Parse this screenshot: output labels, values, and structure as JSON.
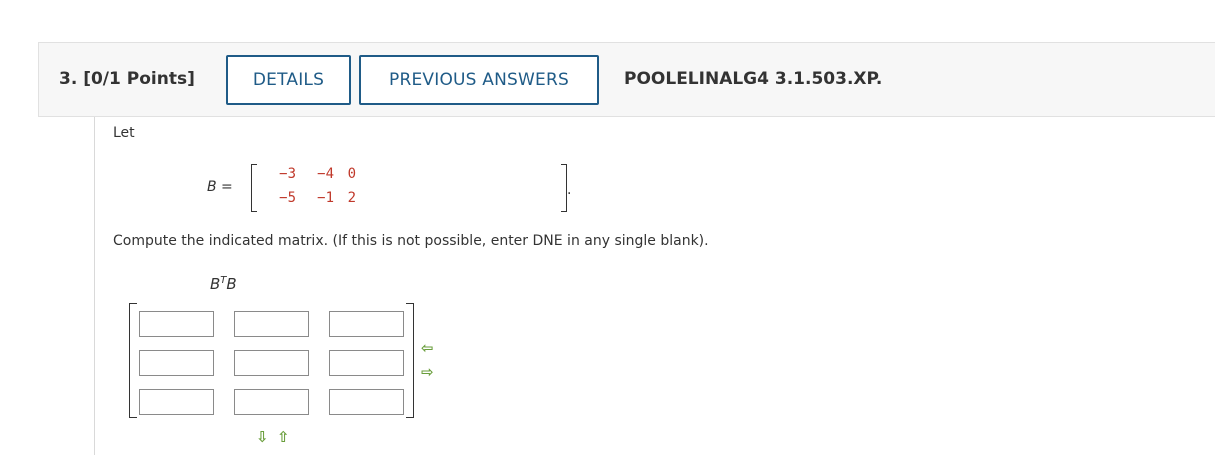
{
  "question": {
    "title": "3.  [0/1 Points]",
    "details_label": "DETAILS",
    "previous_answers_label": "PREVIOUS ANSWERS",
    "course_code": "POOLELINALG4 3.1.503.XP."
  },
  "content": {
    "intro": "Let",
    "matrix_label": "B  =",
    "matrix_values": [
      [
        "−3",
        "−4",
        "0"
      ],
      [
        "−5",
        "−1",
        "2"
      ]
    ],
    "period": ".",
    "instruction": "Compute the indicated matrix. (If this is not possible, enter DNE in any single blank).",
    "expression_base": "B",
    "expression_sup": "T",
    "expression_tail": "B"
  },
  "answer_grid": {
    "rows": 3,
    "cols": 3,
    "values": [
      [
        "",
        "",
        ""
      ],
      [
        "",
        "",
        ""
      ],
      [
        "",
        "",
        ""
      ]
    ]
  },
  "icons": {
    "remove_column": "arrow-left-icon",
    "add_column": "arrow-right-icon",
    "add_row": "arrow-down-icon",
    "remove_row": "arrow-up-icon"
  },
  "colors": {
    "accent": "#1f5b87",
    "matrix_value": "#c0392b",
    "arrow": "#6a9e3c",
    "header_bg": "#f7f7f7"
  }
}
